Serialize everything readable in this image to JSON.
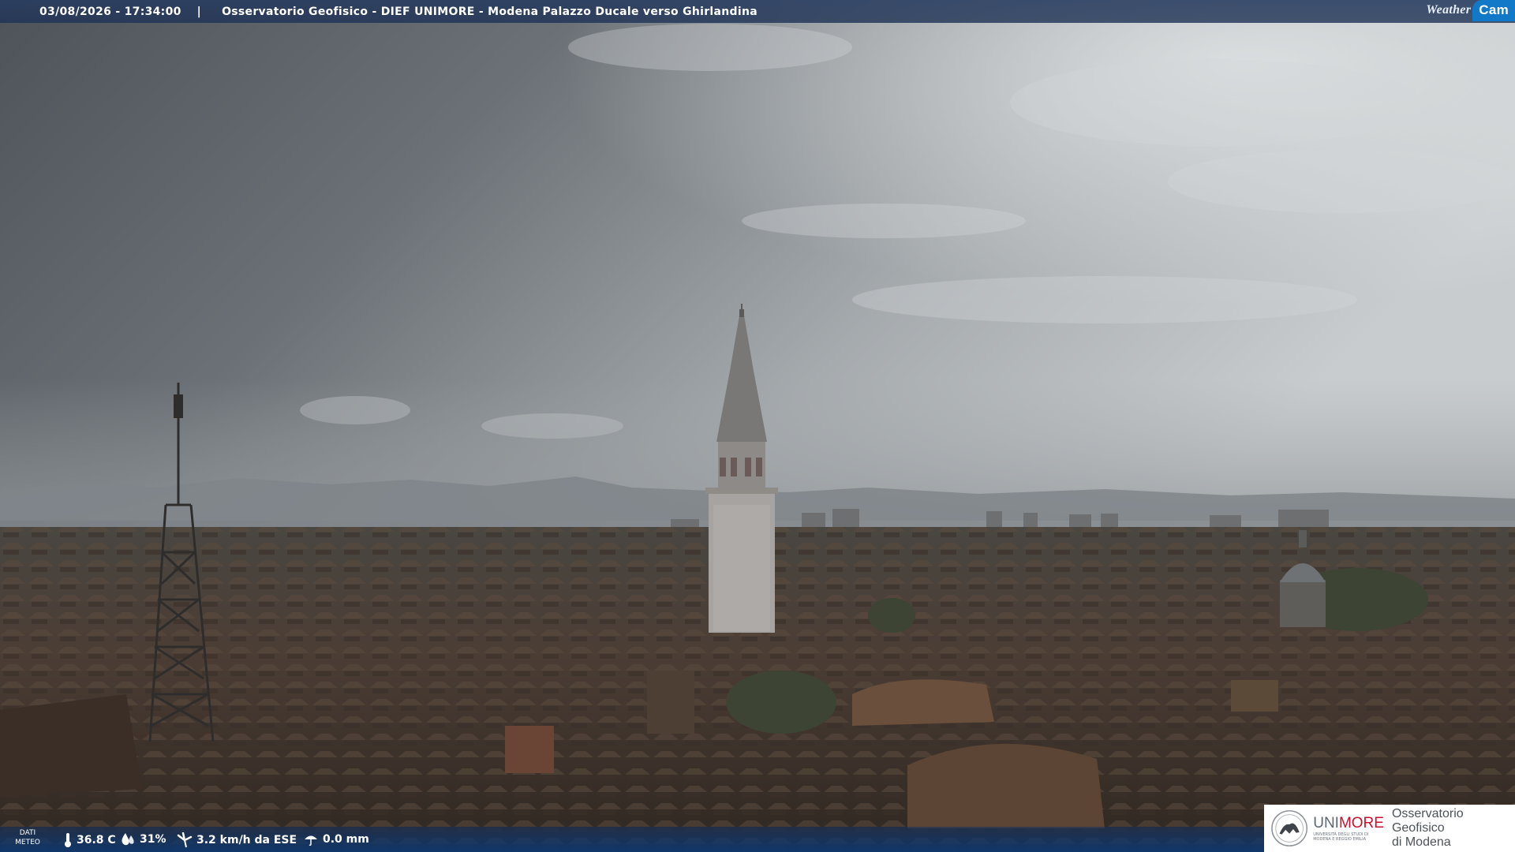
{
  "overlay": {
    "timestamp": "03/08/2026 - 17:34:00",
    "separator": "|",
    "caption": "Osservatorio Geofisico - DIEF UNIMORE - Modena Palazzo Ducale verso Ghirlandina",
    "brand_weather": "Weather",
    "brand_cam": "Cam"
  },
  "weather_data": {
    "label_line1": "DATI",
    "label_line2": "METEO",
    "temperature": "36.8 C",
    "humidity": "31%",
    "wind": "3.2 km/h da ESE",
    "rain": "0.0 mm"
  },
  "logo": {
    "uni": "UNI",
    "more": "MORE",
    "university_line": "UNIVERSITÀ DEGLI STUDI DI MODENA E REGGIO EMILIA",
    "observatory_line1": "Osservatorio Geofisico",
    "observatory_line2": "di Modena"
  },
  "colors": {
    "brand_blue": "#1279c9",
    "unimore_red": "#c8102e",
    "overlay_bar": "#283c5f"
  }
}
